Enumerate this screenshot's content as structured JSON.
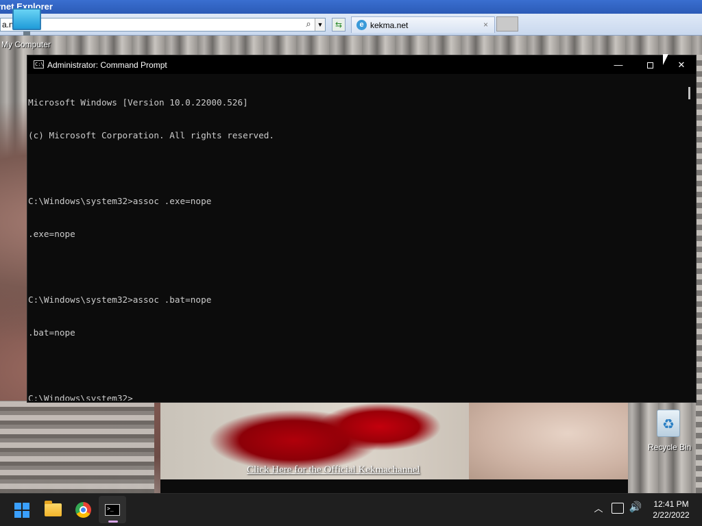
{
  "ie": {
    "title": "rnet Explorer",
    "address_value": "a.ne",
    "tab_label": "kekma.net",
    "tab_close": "×",
    "search_glyph": "⌕",
    "dropdown_glyph": "▼",
    "refresh_glyph": "⇆"
  },
  "desktop": {
    "icons": {
      "my_computer": "My Computer",
      "recycle_bin": "Recycle Bin"
    },
    "banner_link": "Click Here for the Official Kekmachannel"
  },
  "cmd": {
    "title": "Administrator: Command Prompt",
    "icon_text": "C:\\",
    "buttons": {
      "minimize": "—",
      "close": "✕"
    },
    "lines": [
      "Microsoft Windows [Version 10.0.22000.526]",
      "(c) Microsoft Corporation. All rights reserved.",
      "",
      "C:\\Windows\\system32>assoc .exe=nope",
      ".exe=nope",
      "",
      "C:\\Windows\\system32>assoc .bat=nope",
      ".bat=nope",
      "",
      "C:\\Windows\\system32>"
    ],
    "text_color": "#cccccc",
    "background": "#0c0c0c"
  },
  "taskbar": {
    "apps": [
      {
        "name": "Start",
        "icon": "windows-logo-icon"
      },
      {
        "name": "File Explorer",
        "icon": "folder-icon"
      },
      {
        "name": "Google Chrome",
        "icon": "chrome-icon"
      },
      {
        "name": "Command Prompt",
        "icon": "cmd-icon",
        "active": true
      }
    ],
    "tray": {
      "chevron": "︿",
      "volume": "🔊",
      "time": "12:41 PM",
      "date": "2/22/2022"
    },
    "accent": "#3aa0ff"
  }
}
